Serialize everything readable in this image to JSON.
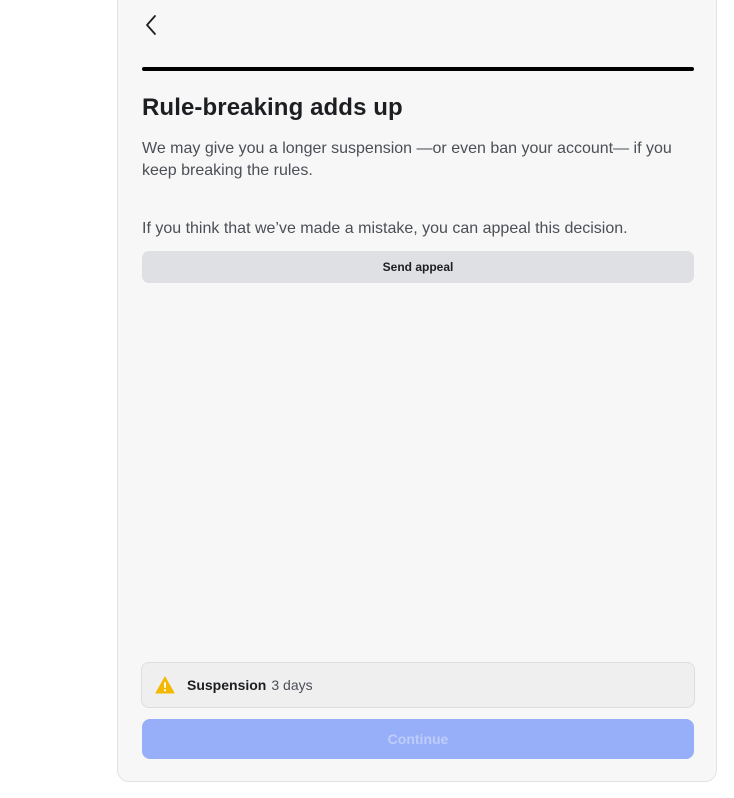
{
  "header": {
    "back_icon": "chevron-left-icon"
  },
  "progress": {
    "value": 1.0
  },
  "content": {
    "title": "Rule-breaking adds up",
    "description": "We may give you a longer suspension —or even ban your account— if you keep breaking the rules.",
    "appeal_prompt": "If you think that we’ve made a mistake, you can appeal this decision.",
    "appeal_button_label": "Send appeal"
  },
  "notice": {
    "icon": "warning-icon",
    "label": "Suspension",
    "value": "3 days",
    "icon_color": "#f5b800"
  },
  "footer": {
    "continue_label": "Continue",
    "continue_disabled": true,
    "continue_color": "#97aef9"
  }
}
